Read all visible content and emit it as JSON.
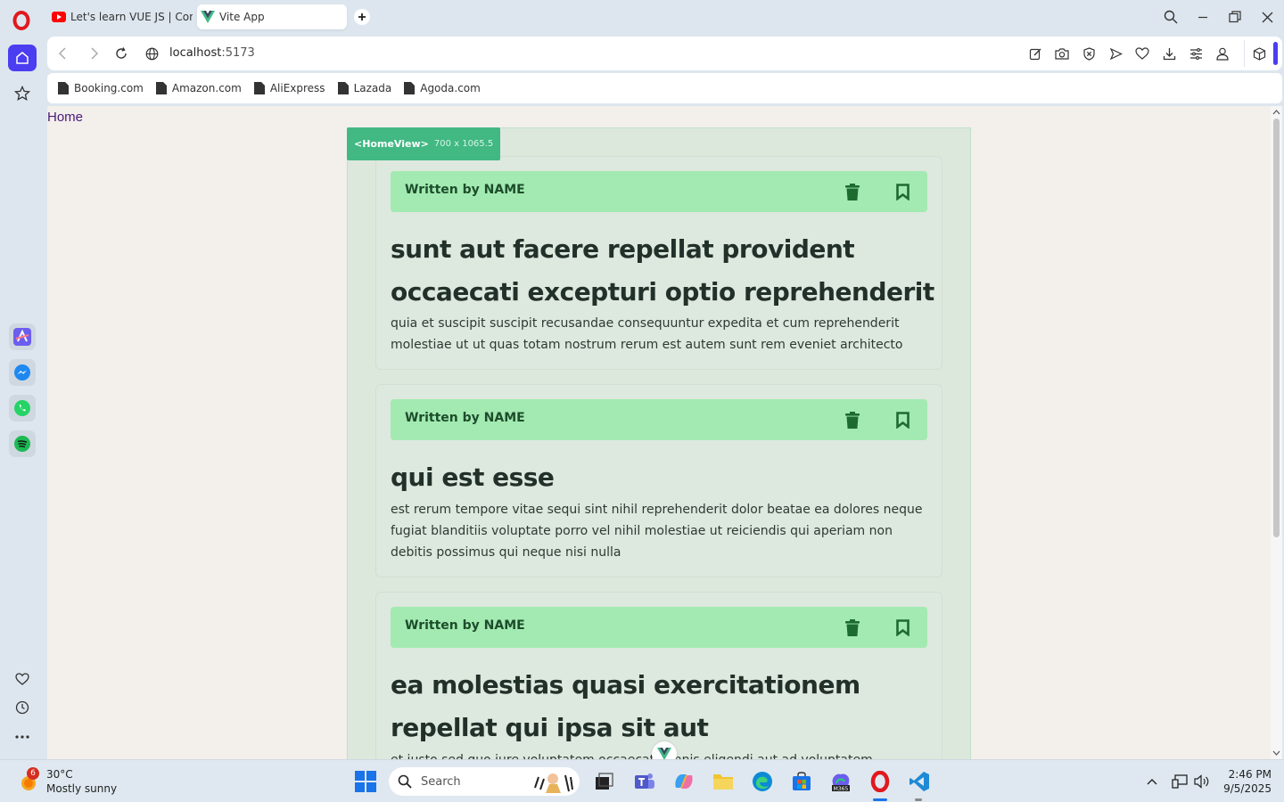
{
  "browser": {
    "tabs": [
      {
        "label": "Let's learn VUE JS | Compo",
        "active": false,
        "favicon": "youtube-icon"
      },
      {
        "label": "Vite App",
        "active": true,
        "favicon": "vue-icon"
      }
    ],
    "address": {
      "host": "localhost",
      "port": ":5173"
    },
    "bookmarks": [
      {
        "label": "Booking.com"
      },
      {
        "label": "Amazon.com"
      },
      {
        "label": "AliExpress"
      },
      {
        "label": "Lazada"
      },
      {
        "label": "Agoda.com"
      }
    ]
  },
  "page": {
    "nav_home": "Home",
    "devtools_tag": {
      "component": "<HomeView>",
      "dimensions": "700 x 1065.5"
    },
    "posts": [
      {
        "author": "Written by NAME",
        "title": "sunt aut facere repellat provident occaecati excepturi optio reprehenderit",
        "body": "quia et suscipit suscipit recusandae consequuntur expedita et cum reprehenderit molestiae ut ut quas totam nostrum rerum est autem sunt rem eveniet architecto"
      },
      {
        "author": "Written by NAME",
        "title": "qui est esse",
        "body": "est rerum tempore vitae sequi sint nihil reprehenderit dolor beatae ea dolores neque fugiat blanditiis voluptate porro vel nihil molestiae ut reiciendis qui aperiam non debitis possimus qui neque nisi nulla"
      },
      {
        "author": "Written by NAME",
        "title": "ea molestias quasi exercitationem repellat qui ipsa sit aut",
        "body": "et iusto sed quo iure voluptatem occaecati omnis eligendi aut ad voluptatem"
      }
    ]
  },
  "taskbar": {
    "weather": {
      "temp": "30°C",
      "condition": "Mostly sunny",
      "badge": "6"
    },
    "search_placeholder": "Search",
    "clock": {
      "time": "2:46 PM",
      "date": "9/5/2025"
    }
  },
  "colors": {
    "opera_accent": "#4b3df0",
    "vue_green": "#42b883",
    "card_header": "#a2eab1",
    "icon_green": "#1e6b2f"
  }
}
